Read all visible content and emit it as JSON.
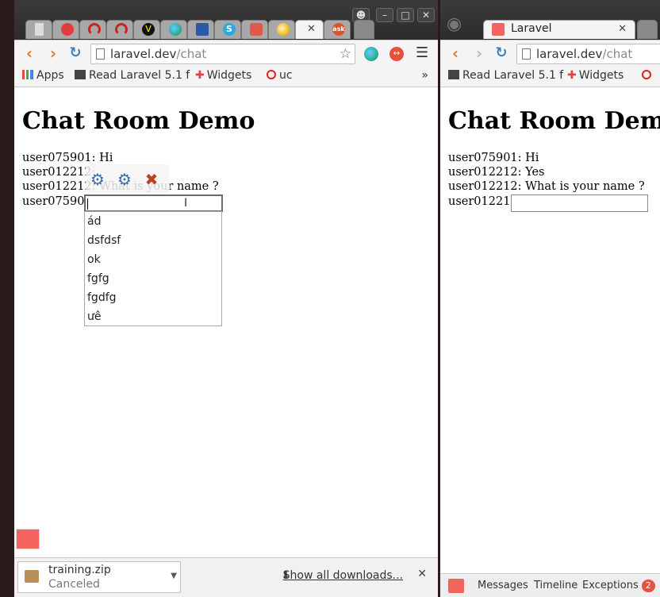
{
  "left_window": {
    "tabs": [
      {
        "name": "tab-blank",
        "color": "#dddddd"
      },
      {
        "name": "tab-red-circle",
        "color": "#e53b3b"
      },
      {
        "name": "tab-red-arc-1",
        "color": "#cc2222"
      },
      {
        "name": "tab-red-arc-2",
        "color": "#cc2222"
      },
      {
        "name": "tab-v",
        "color": "#111111",
        "glyph": "V"
      },
      {
        "name": "tab-globe",
        "color": "#3a9a5a"
      },
      {
        "name": "tab-blue-icon",
        "color": "#2b58a8"
      },
      {
        "name": "tab-skype",
        "color": "#2aa9e0",
        "glyph": "S"
      },
      {
        "name": "tab-ext",
        "color": "#e05a4a"
      },
      {
        "name": "tab-yellow",
        "color": "#f0b020"
      },
      {
        "name": "tab-active-close",
        "glyph": "✕"
      },
      {
        "name": "tab-ask",
        "color": "#e0502a",
        "glyph": "ask"
      }
    ],
    "url_host": "laravel.dev",
    "url_path": "/chat",
    "bookmarks": {
      "apps": "Apps",
      "read_laravel": "Read Laravel 5.1 f",
      "widgets": "Widgets",
      "uc": "uc",
      "more": "»"
    },
    "page": {
      "title": "Chat Room Demo",
      "messages": [
        "user075901: Hi",
        "user012212:",
        "user012212: What is your name ?"
      ],
      "current_user": "user075901"
    },
    "autocomplete": [
      "ád",
      "dsfdsf",
      "ok",
      "fgfg",
      "fgdfg",
      "ưê"
    ],
    "download": {
      "filename": "training.zip",
      "status": "Canceled",
      "show_all": "Show all downloads...",
      "close": "✕"
    }
  },
  "right_window": {
    "tab_title": "Laravel",
    "tab_close": "✕",
    "url_host": "laravel.dev",
    "url_path": "/chat",
    "bookmarks": {
      "read_laravel": "Read Laravel 5.1 f",
      "widgets": "Widgets"
    },
    "page": {
      "title": "Chat Room Demo",
      "messages": [
        "user075901: Hi",
        "user012212: Yes",
        "user012212: What is your name ?"
      ],
      "current_user": "user012212"
    },
    "debugbar": {
      "messages": "Messages",
      "timeline": "Timeline",
      "exceptions": "Exceptions",
      "exceptions_count": "2"
    }
  }
}
